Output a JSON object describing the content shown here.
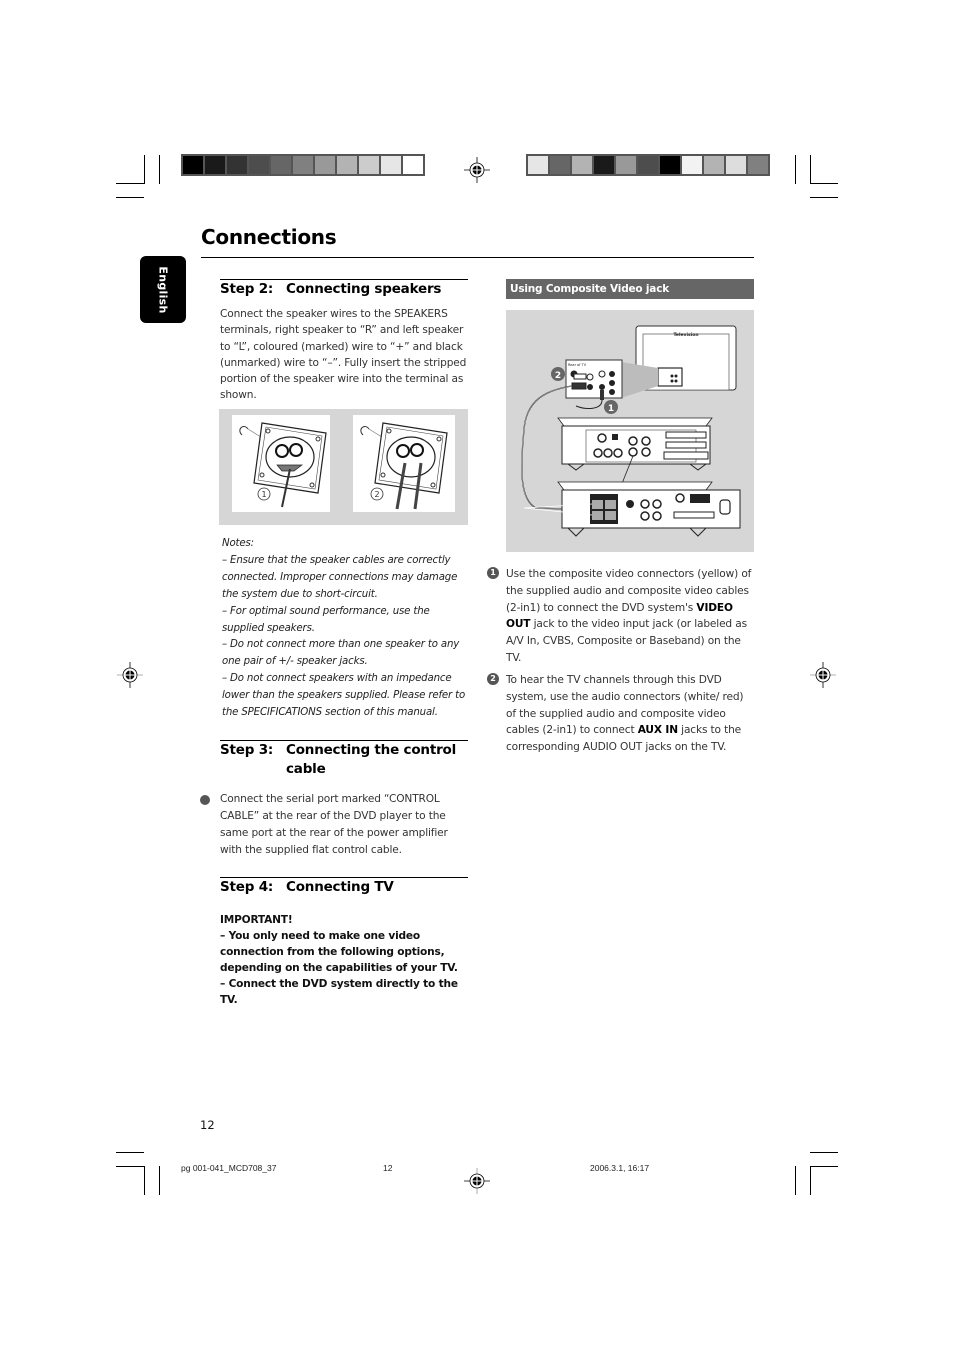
{
  "page": {
    "title": "Connections",
    "language_tab": "English",
    "page_number": "12"
  },
  "colorbars": {
    "left": [
      "#000000",
      "#1a1a1a",
      "#333333",
      "#4d4d4d",
      "#666666",
      "#808080",
      "#999999",
      "#b3b3b3",
      "#cccccc",
      "#e6e6e6",
      "#ffffff"
    ],
    "right": [
      "#e6e6e6",
      "#666666",
      "#b3b3b3",
      "#1a1a1a",
      "#999999",
      "#4d4d4d",
      "#000000",
      "#f2f2f2",
      "#b3b3b3",
      "#dddddd",
      "#808080"
    ]
  },
  "step2": {
    "num": "Step 2:",
    "title": "Connecting speakers",
    "text": "Connect the speaker wires to the SPEAKERS terminals, right speaker to “R” and left speaker to “L”, coloured (marked) wire to “+” and black (unmarked) wire to “–”. Fully insert the stripped portion of the speaker wire into the terminal as shown.",
    "figure_labels": [
      "1",
      "2"
    ],
    "notes_heading": "Notes:",
    "notes": [
      "–   Ensure that the speaker cables are correctly connected. Improper connections may damage the system due to short-circuit.",
      "–   For optimal sound performance, use the supplied speakers.",
      "–   Do not connect more than one speaker to any one pair of +/- speaker jacks.",
      "–   Do not connect speakers with an impedance lower than the speakers supplied. Please refer to the SPECIFICATIONS section of this manual."
    ]
  },
  "step3": {
    "num": "Step 3:",
    "title": "Connecting the control cable",
    "text": "Connect the serial port marked “CONTROL CABLE” at the rear of the DVD player to the same port at the rear of the power amplifier with the supplied flat control cable."
  },
  "step4": {
    "num": "Step 4:",
    "title": "Connecting TV",
    "important_heading": "IMPORTANT!",
    "important_lines": [
      "–   You only need to make one video connection from the following options, depending on the capabilities of your TV.",
      "–   Connect the DVD system directly to the TV."
    ]
  },
  "composite": {
    "header": "Using Composite Video jack",
    "diagram": {
      "tv_label": "Television",
      "rear_label": "Rear of TV",
      "callouts": [
        "1",
        "2"
      ]
    },
    "items": [
      {
        "num": "1",
        "pre": "Use the composite video connectors (yellow) of the supplied audio and composite video cables (2-in1) to connect the DVD system's ",
        "bold": "VIDEO OUT",
        "post": " jack to the video input jack (or labeled as A/V In, CVBS, Composite or Baseband) on the TV."
      },
      {
        "num": "2",
        "pre": "To hear the TV channels through this DVD system, use the audio connectors (white/ red) of the supplied audio and composite video cables (2-in1) to connect ",
        "bold": "AUX IN",
        "post": " jacks to the corresponding AUDIO OUT jacks on the TV."
      }
    ]
  },
  "footer": {
    "file": "pg 001-041_MCD708_37",
    "page": "12",
    "timestamp": "2006.3.1, 16:17"
  }
}
